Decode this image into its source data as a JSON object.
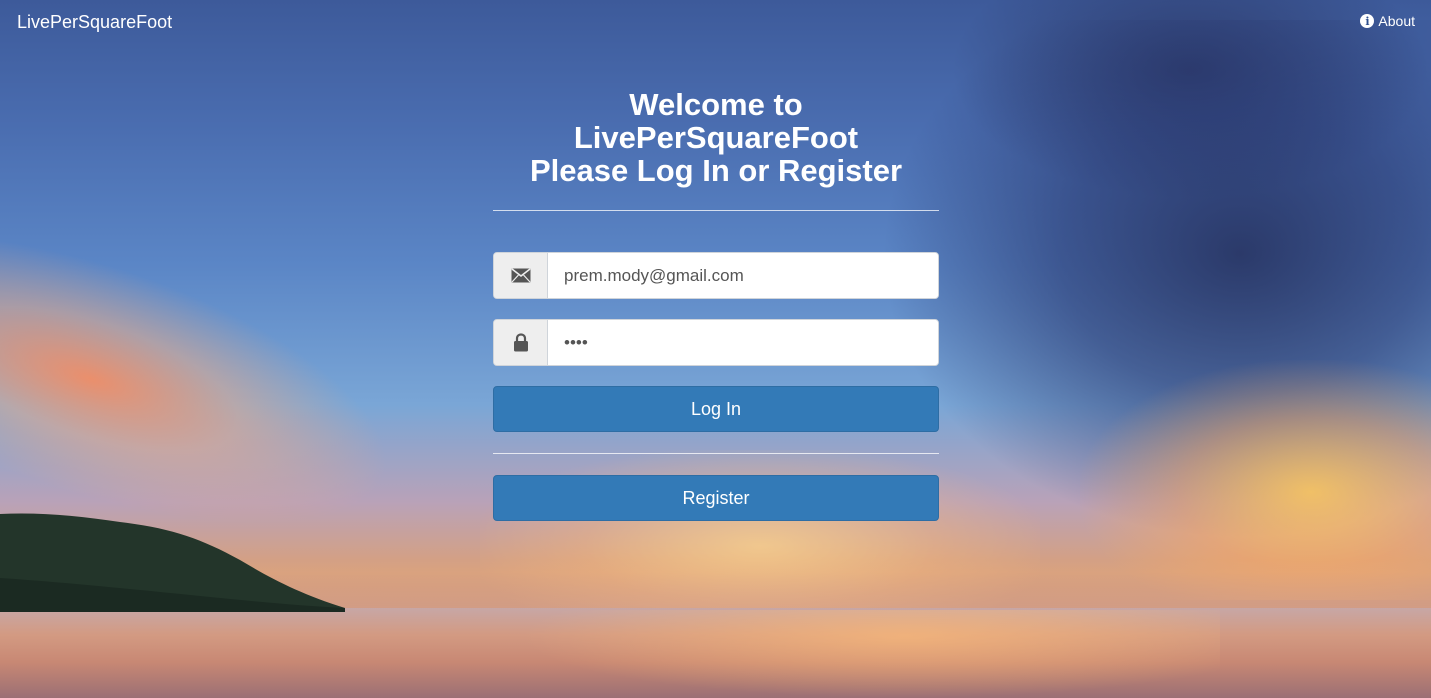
{
  "navbar": {
    "brand": "LivePerSquareFoot",
    "about_label": "About",
    "about_icon": "info-icon"
  },
  "login": {
    "title_line1": "Welcome to LivePerSquareFoot",
    "title_line2": "Please Log In or Register",
    "email": {
      "icon": "envelope-icon",
      "value": "prem.mody@gmail.com"
    },
    "password": {
      "icon": "lock-icon",
      "value": "••••"
    },
    "login_button": "Log In",
    "register_button": "Register"
  },
  "colors": {
    "primary_button": "#337ab7",
    "text_on_dark": "#ffffff",
    "addon_bg": "#eeeeee"
  }
}
